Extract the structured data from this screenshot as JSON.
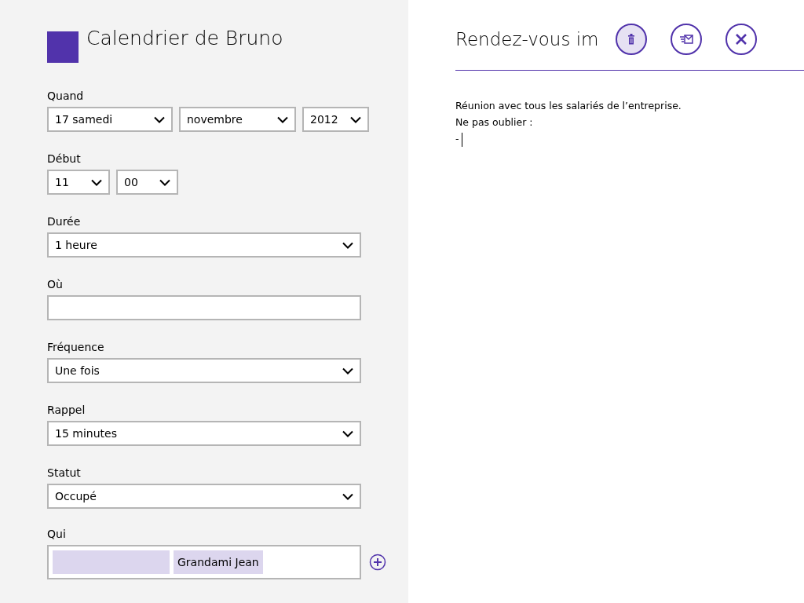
{
  "calendar": {
    "name": "Calendrier de Bruno",
    "color": "#5133ab"
  },
  "fields": [
    {
      "label": "Quand",
      "kind": "selects",
      "selects": [
        {
          "kind": "day",
          "value": "17 samedi"
        },
        {
          "kind": "month",
          "value": "novembre"
        },
        {
          "kind": "year",
          "value": "2012"
        }
      ]
    },
    {
      "label": "Début",
      "kind": "selects",
      "selects": [
        {
          "kind": "hour",
          "value": "11"
        },
        {
          "kind": "minute",
          "value": "00"
        }
      ]
    },
    {
      "label": "Durée",
      "kind": "selects",
      "selects": [
        {
          "kind": "full",
          "value": "1 heure"
        }
      ]
    },
    {
      "label": "Où",
      "kind": "text"
    },
    {
      "label": "Fréquence",
      "kind": "selects",
      "selects": [
        {
          "kind": "full",
          "value": "Une fois"
        }
      ]
    },
    {
      "label": "Rappel",
      "kind": "selects",
      "selects": [
        {
          "kind": "full",
          "value": "15 minutes"
        }
      ]
    },
    {
      "label": "Statut",
      "kind": "selects",
      "selects": [
        {
          "kind": "full",
          "value": "Occupé"
        }
      ]
    },
    {
      "label": "Qui",
      "kind": "attendees",
      "attendees": [
        {
          "kind": "blank"
        },
        {
          "kind": "name",
          "name": "Grandami Jean"
        }
      ]
    }
  ],
  "event": {
    "title": "Rendez-vous im",
    "actions": [
      {
        "kind": "delete",
        "highlighted": true
      },
      {
        "kind": "send",
        "highlighted": false
      },
      {
        "kind": "close",
        "highlighted": false
      }
    ],
    "body": [
      "Réunion avec tous les salariés de l’entreprise.",
      "Ne pas oublier :",
      "-"
    ]
  }
}
